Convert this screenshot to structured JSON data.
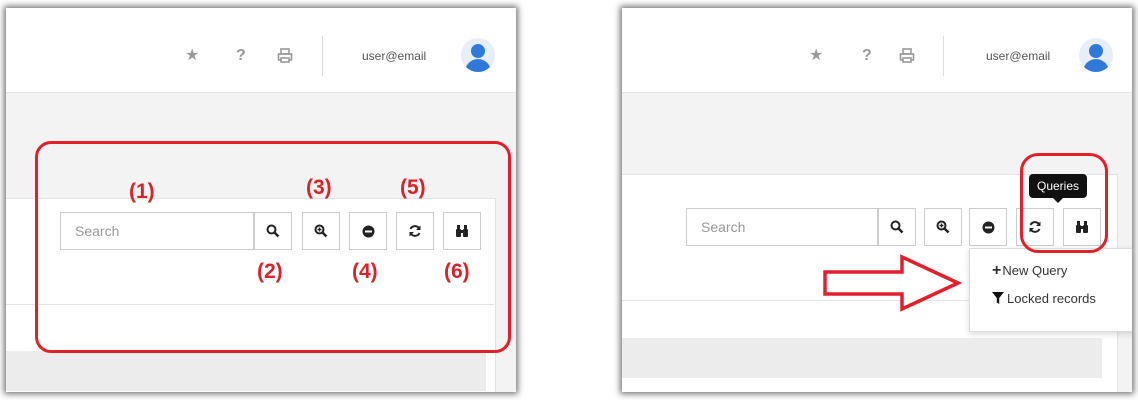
{
  "header": {
    "user_email": "user@email",
    "icons": [
      "star-icon",
      "help-icon",
      "printer-icon",
      "user-avatar"
    ]
  },
  "toolbar": {
    "search_placeholder": "Search",
    "buttons": [
      "search-icon",
      "zoom-in-icon",
      "minus-circle-icon",
      "refresh-icon",
      "binoculars-icon"
    ]
  },
  "callouts": {
    "n1": "(1)",
    "n2": "(2)",
    "n3": "(3)",
    "n4": "(4)",
    "n5": "(5)",
    "n6": "(6)"
  },
  "queries": {
    "tooltip": "Queries",
    "menu": [
      {
        "icon": "plus-icon",
        "label": "New Query"
      },
      {
        "icon": "filter-icon",
        "label": "Locked records"
      }
    ]
  },
  "colors": {
    "annotation_red": "#e3202a",
    "avatar_blue": "#2f7ad8"
  }
}
